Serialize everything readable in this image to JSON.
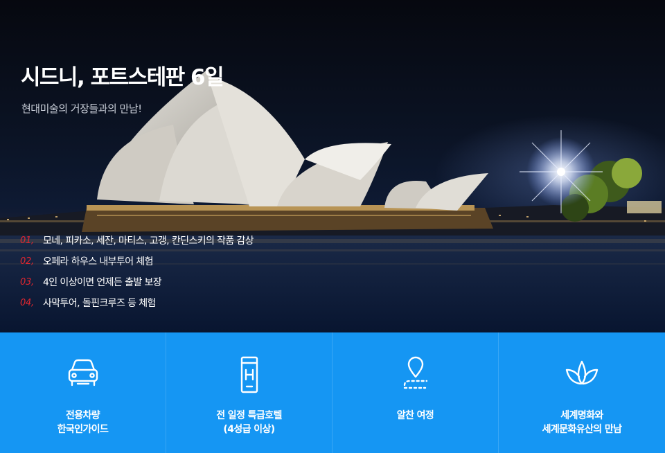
{
  "hero": {
    "title": "시드니, 포트스테판 6일",
    "subtitle": "현대미술의 거장들과의 만남!",
    "features": [
      {
        "num": "01,",
        "text": "모네, 피카소, 세잔, 마티스, 고갱, 칸딘스키의 작품 감상"
      },
      {
        "num": "02,",
        "text": "오페라 하우스 내부투어 체험"
      },
      {
        "num": "03,",
        "text": "4인 이상이면 언제든 출발 보장"
      },
      {
        "num": "04,",
        "text": "사막투어, 돌핀크루즈 등 체험"
      }
    ]
  },
  "bar": {
    "background": "#1596f3",
    "items": [
      {
        "icon": "car-icon",
        "line1": "전용차량",
        "line2": "한국인가이드"
      },
      {
        "icon": "hotel-icon",
        "line1": "전 일정 특급호텔",
        "line2": "(4성급 이상)"
      },
      {
        "icon": "route-pin-icon",
        "line1": "알찬 여정",
        "line2": ""
      },
      {
        "icon": "lotus-icon",
        "line1": "세계명화와",
        "line2": "세계문화유산의 만남"
      }
    ]
  },
  "colors": {
    "accent_number": "#e3262f"
  }
}
